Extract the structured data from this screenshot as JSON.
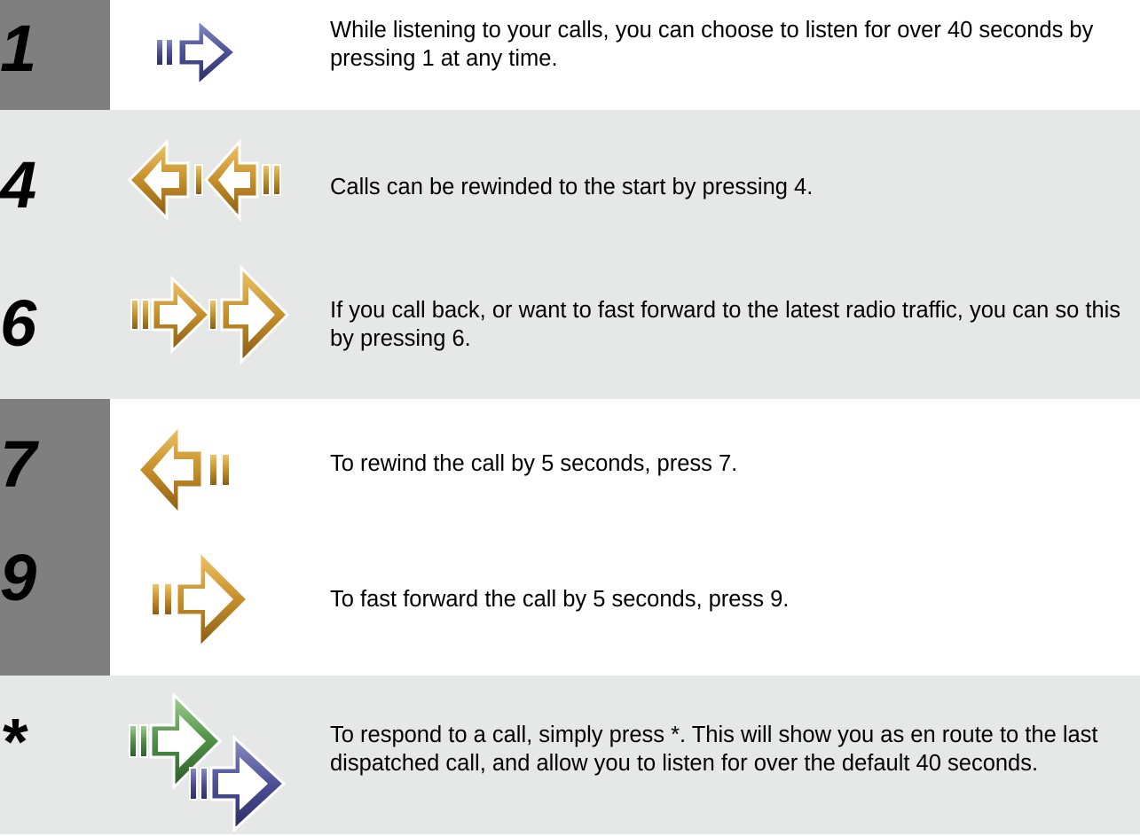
{
  "rows": [
    {
      "key": "1",
      "icon": "play-forward-icon",
      "text": "While listening to your calls, you can choose to listen for over 40 seconds by pressing 1 at any time."
    },
    {
      "key": "4",
      "icon": "rewind-to-start-icon",
      "text": "Calls can be rewinded to the start by pressing 4."
    },
    {
      "key": "6",
      "icon": "fast-forward-latest-icon",
      "text": "If you call back, or want to fast forward to the latest radio traffic, you can so this by pressing 6."
    },
    {
      "key": "7",
      "icon": "rewind-5-seconds-icon",
      "text": "To rewind the call by 5 seconds, press 7."
    },
    {
      "key": "9",
      "icon": "forward-5-seconds-icon",
      "text": "To fast forward the call by 5 seconds, press 9."
    },
    {
      "key": "*",
      "icon": "respond-en-route-icon",
      "text": "To respond to a call, simply press *.  This will show you as en route to the last dispatched call, and allow you to listen for over the default 40 seconds."
    }
  ],
  "colors": {
    "band_light": "#e6e7e7",
    "key_column": "#7f7f7f",
    "icon_blue": "#3b3f7e",
    "icon_gold": "#b07a1f",
    "icon_green": "#3f7a36"
  }
}
